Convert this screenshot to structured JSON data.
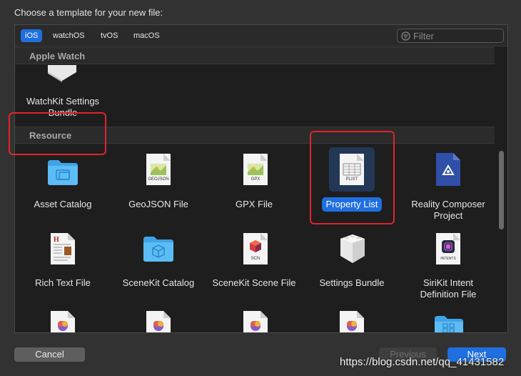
{
  "dialog": {
    "title": "Choose a template for your new file:"
  },
  "platform_tabs": [
    "iOS",
    "watchOS",
    "tvOS",
    "macOS"
  ],
  "filter": {
    "placeholder": "Filter",
    "value": ""
  },
  "sections": {
    "apple_watch": "Apple Watch",
    "resource": "Resource"
  },
  "apple_watch_items": [
    {
      "label": "WatchKit Settings Bundle"
    }
  ],
  "resource_items": [
    {
      "label": "Asset Catalog",
      "icon": "folder-icon"
    },
    {
      "label": "GeoJSON File",
      "icon": "geojson-file-icon",
      "badge": "GEOJSON"
    },
    {
      "label": "GPX File",
      "icon": "gpx-file-icon",
      "badge": "GPX"
    },
    {
      "label": "Property List",
      "icon": "plist-file-icon",
      "badge": "PLIST",
      "selected": true
    },
    {
      "label": "Reality Composer Project",
      "icon": "reality-composer-icon"
    },
    {
      "label": "Rich Text File",
      "icon": "rich-text-file-icon"
    },
    {
      "label": "SceneKit Catalog",
      "icon": "folder-icon"
    },
    {
      "label": "SceneKit Scene File",
      "icon": "scn-file-icon",
      "badge": "SCN"
    },
    {
      "label": "Settings Bundle",
      "icon": "settings-bundle-icon"
    },
    {
      "label": "SiriKit Intent Definition File",
      "icon": "intents-file-icon",
      "badge": "INTENTS"
    }
  ],
  "buttons": {
    "cancel": "Cancel",
    "previous": "Previous",
    "next": "Next"
  },
  "watermark": "https://blog.csdn.net/qq_41431582",
  "colors": {
    "accent": "#1f6fe0",
    "annotation": "#e0242b",
    "background": "#323232",
    "panel": "#1e1e1e"
  }
}
